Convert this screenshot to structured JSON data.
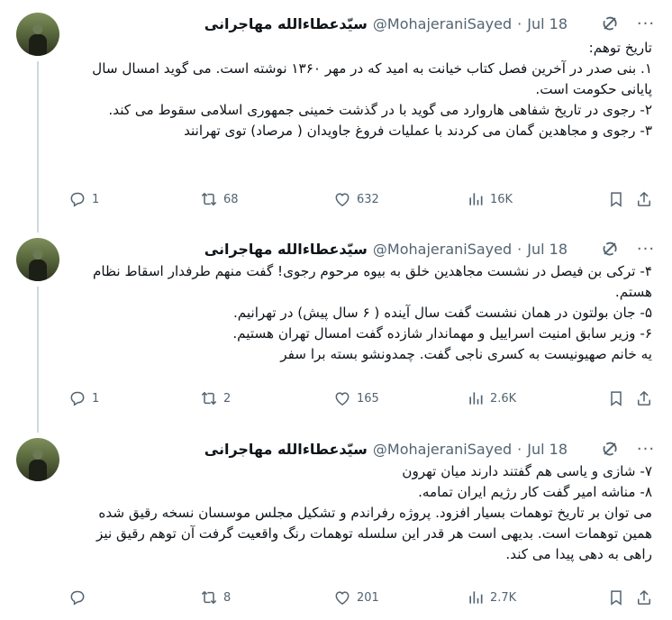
{
  "author": {
    "display_name": "سیّدعطاءالله مهاجرانی",
    "handle": "@MohajeraniSayed"
  },
  "separator": "·",
  "tweets": [
    {
      "date": "Jul 18",
      "lines": [
        "تاریخ توهم:",
        "۱. بنی صدر در آخرین فصل کتاب خیانت به امید که در مهر ۱۳۶۰ نوشته است. می گوید امسال سال پایانی حکومت است.",
        "۲- رجوی در تاریخ شفاهی هاروارد می گوید با در گذشت  خمینی جمهوری اسلامی سقوط می کند.",
        "۳- رجوی و مجاهدین گمان می کردند با عملیات فروغ جاویدان ( مرصاد) توی تهرانند"
      ],
      "stats": {
        "replies": "1",
        "reposts": "68",
        "likes": "632",
        "views": "16K"
      }
    },
    {
      "date": "Jul 18",
      "lines": [
        "۴- ترکی بن فیصل در نشست مجاهدین خلق به بیوه مرحوم رجوی! گفت منهم طرفدار اسقاط نظام هستم.",
        "۵- جان بولتون در همان نشست گفت سال آینده ( ۶ سال پیش) در تهرانیم.",
        "۶- وزیر سابق امنیت اسراییل و مهماندار شازده گفت امسال تهران هستیم.",
        "یه خانم صهیونیست به کسری ناجی گفت. چمدونشو بسته برا سفر"
      ],
      "stats": {
        "replies": "1",
        "reposts": "2",
        "likes": "165",
        "views": "2.6K"
      }
    },
    {
      "date": "Jul 18",
      "lines": [
        "۷- شازی و یاسی هم گفتند دارند میان تهرون",
        "۸- مناشه امیر گفت کار رژیم ایران تمامه.",
        "می توان بر تاریخ توهمات بسیار افزود. پروژه رفراندم و تشکیل مجلس موسسان نسخه رقیق شده همین توهمات است. بدیهی است هر قدر این سلسله توهمات رنگ واقعیت گرفت آن توهم رقیق نیز راهی به دهی پیدا می کند."
      ],
      "stats": {
        "replies": "",
        "reposts": "8",
        "likes": "201",
        "views": "2.7K"
      }
    }
  ],
  "icons": [
    "more-icon",
    "grok-icon",
    "reply-icon",
    "repost-icon",
    "like-icon",
    "views-icon",
    "bookmark-icon",
    "share-icon"
  ],
  "colors": {
    "text": "#0f1419",
    "secondary": "#536471",
    "thread_line": "#cfd9de"
  }
}
